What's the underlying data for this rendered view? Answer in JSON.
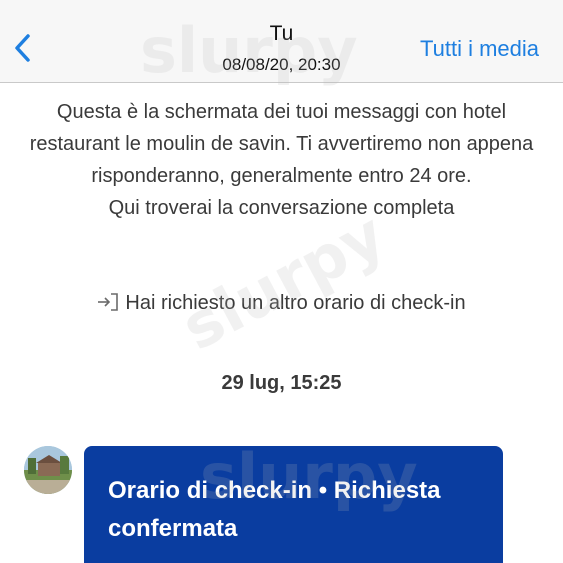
{
  "header": {
    "back_icon": "chevron-left-icon",
    "title": "Tu",
    "subtitle": "08/08/20, 20:30",
    "media_link": "Tutti i media",
    "accent_color": "#1e7fe0"
  },
  "intro": {
    "line1": "Questa è la schermata dei tuoi messaggi con hotel restaurant le moulin de savin. Ti avvertiremo non appena risponderanno, generalmente entro 24 ore.",
    "line2": "Qui troverai la conversazione completa"
  },
  "checkin_note": {
    "icon": "enter-icon",
    "text": "Hai richiesto un altro orario di check-in"
  },
  "date_stamp": "29 lug, 15:25",
  "message": {
    "avatar": "hotel-avatar",
    "text": "Orario di check-in • Richiesta confermata",
    "bubble_color": "#0a3da0"
  },
  "watermark": "slurpy"
}
